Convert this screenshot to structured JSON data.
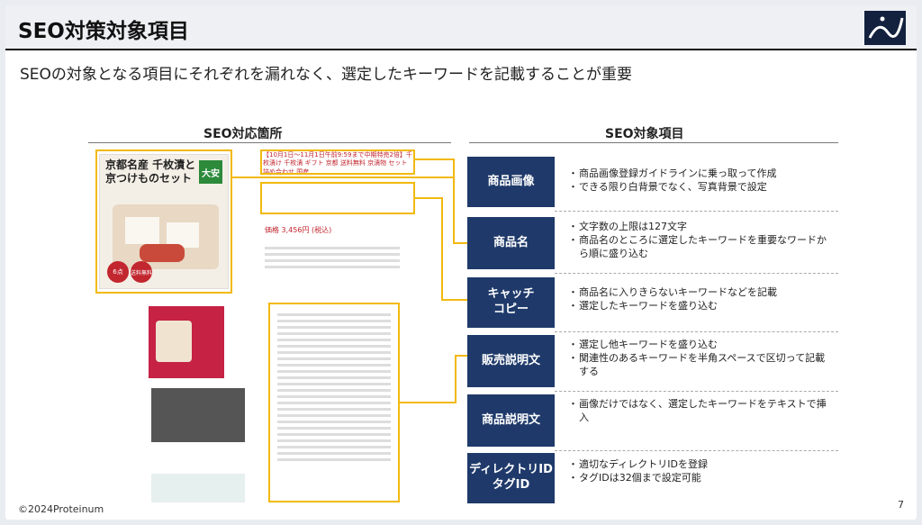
{
  "title": "SEO対策対象項目",
  "subtitle": "SEOの対象となる項目にそれぞれを漏れなく、選定したキーワードを記載することが重要",
  "left_head": "SEO対応箇所",
  "right_head": "SEO対象項目",
  "product_card": {
    "line1": "京都名産 千枚漬と",
    "line2": "京つけものセット",
    "badge": "大安",
    "circle1": "6点",
    "circle2": "送料無料"
  },
  "catch_text": "【10月1日〜11月1日午前9:59まで中期特売2倍】千枚漬け 千枚漬 ギフト 京都 送料無料 京漬物 セット 詰め合わせ 国産",
  "price": "価格 3,456円 (税込)",
  "items": [
    {
      "label": "商品画像",
      "bullets": [
        "商品画像登録ガイドラインに乗っ取って作成",
        "できる限り白背景でなく、写真背景で設定"
      ]
    },
    {
      "label": "商品名",
      "bullets": [
        "文字数の上限は127文字",
        "商品名のところに選定したキーワードを重要なワードから順に盛り込む"
      ]
    },
    {
      "label": "キャッチ\nコピー",
      "bullets": [
        "商品名に入りきらないキーワードなどを記載",
        "選定したキーワードを盛り込む"
      ]
    },
    {
      "label": "販売説明文",
      "bullets": [
        "選定し他キーワードを盛り込む",
        "関連性のあるキーワードを半角スペースで区切って記載する"
      ]
    },
    {
      "label": "商品説明文",
      "bullets": [
        "画像だけではなく、選定したキーワードをテキストで挿入"
      ]
    },
    {
      "label": "ディレクトリID\nタグID",
      "bullets": [
        "適切なディレクトリIDを登録",
        "タグIDは32個まで設定可能"
      ]
    }
  ],
  "footer": "©2024Proteinum",
  "page_number": "7",
  "colors": {
    "navy": "#1f3a6a",
    "highlight": "#f2b90f"
  }
}
